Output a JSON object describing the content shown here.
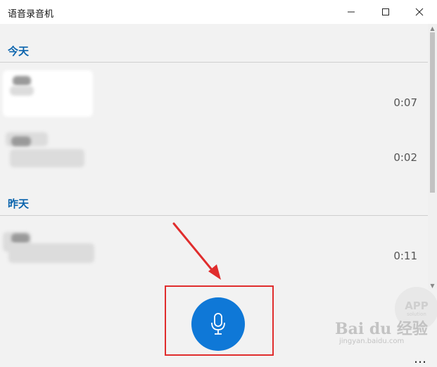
{
  "app": {
    "title": "语音录音机"
  },
  "sections": [
    {
      "header": "今天",
      "items": [
        {
          "duration": "0:07"
        },
        {
          "duration": "0:02"
        }
      ]
    },
    {
      "header": "昨天",
      "items": [
        {
          "duration": "0:11"
        }
      ]
    }
  ],
  "toolbar": {
    "more_label": "…"
  },
  "watermarks": {
    "app_big": "APP",
    "app_small": "solution",
    "baidu_logo": "Bai du 经验",
    "baidu_url": "jingyan.baidu.com"
  },
  "colors": {
    "accent": "#0f78d7",
    "section_header": "#0a64ad",
    "highlight_box": "#e02d2d",
    "annotation_arrow": "#e02d2d"
  },
  "icons": {
    "record": "microphone-icon",
    "minimize": "minimize-icon",
    "maximize": "maximize-icon",
    "close": "close-icon"
  }
}
